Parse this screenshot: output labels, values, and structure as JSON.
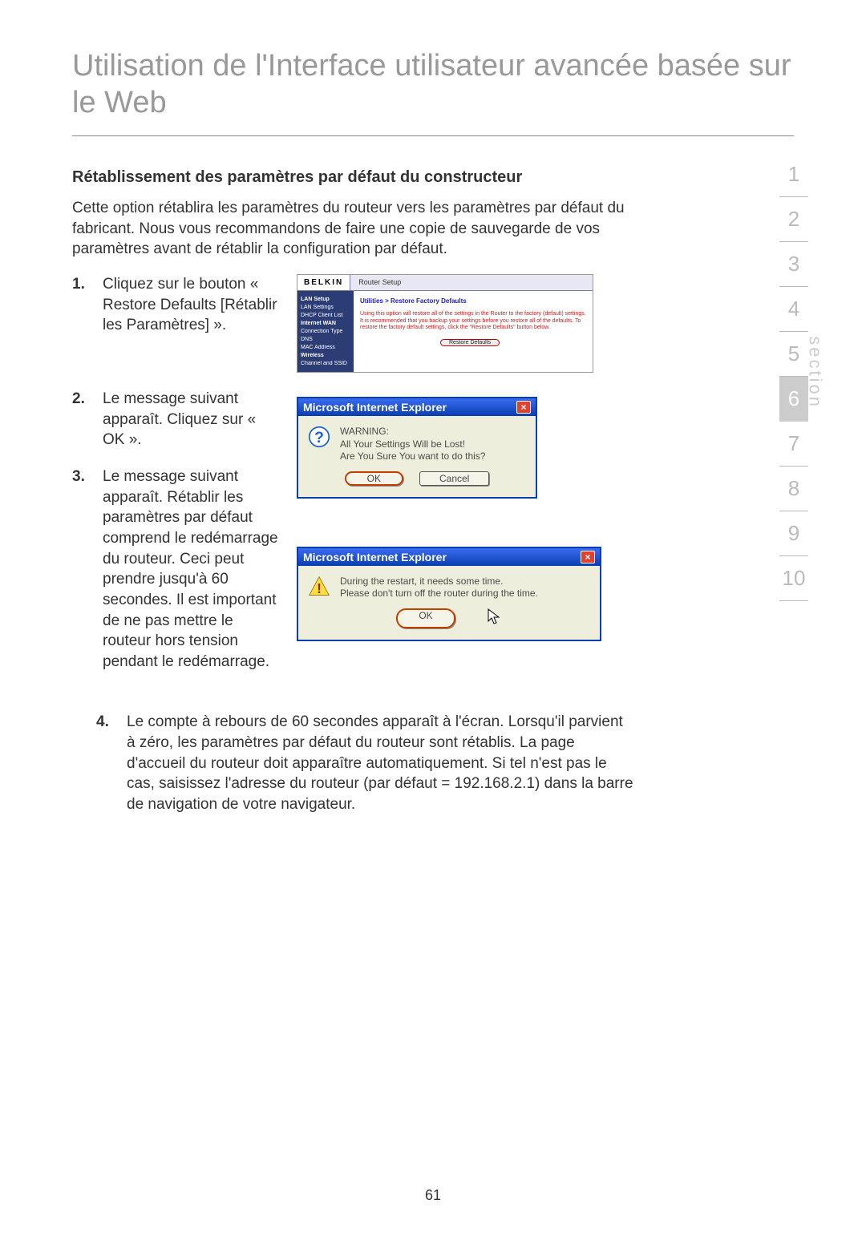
{
  "title": "Utilisation de l'Interface utilisateur avancée basée sur le Web",
  "section_heading": "Rétablissement des paramètres par défaut du constructeur",
  "intro": "Cette option rétablira les paramètres du routeur vers les paramètres par défaut du fabricant. Nous vous recommandons de faire une copie de sauvegarde de vos paramètres avant de rétablir la configuration par défaut.",
  "steps": {
    "s1": {
      "num": "1.",
      "text": "Cliquez sur le bouton « Restore Defaults [Rétablir les Paramètres] »."
    },
    "s2": {
      "num": "2.",
      "text": "Le message suivant apparaît. Cliquez sur « OK »."
    },
    "s3": {
      "num": "3.",
      "text": "Le message suivant apparaît. Rétablir les paramètres par défaut comprend le redémarrage du routeur. Ceci peut prendre jusqu'à 60 secondes. Il est important de ne pas mettre le routeur hors tension pendant le redémarrage."
    },
    "s4": {
      "num": "4.",
      "text": "Le compte à rebours de 60 secondes apparaît à l'écran. Lorsqu'il parvient à zéro, les paramètres par défaut du routeur sont rétablis. La page d'accueil du routeur doit apparaître automatiquement. Si tel n'est pas le cas, saisissez l'adresse du routeur (par défaut = 192.168.2.1) dans la barre de navigation de votre navigateur."
    }
  },
  "router": {
    "logo": "BELKIN",
    "tab": "Router Setup",
    "side": {
      "lan": "LAN Setup",
      "lan1": "LAN Settings",
      "lan2": "DHCP Client List",
      "wan": "Internet WAN",
      "wan1": "Connection Type",
      "wan2": "DNS",
      "wan3": "MAC Address",
      "wireless": "Wireless",
      "w1": "Channel and SSID"
    },
    "crumb": "Utilities > Restore Factory Defaults",
    "desc": "Using this option will restore all of the settings in the Router to the factory (default) settings. It is recommended that you backup your settings before you restore all of the defaults. To restore the factory default settings, click the \"Restore Defaults\" button below.",
    "button": "Restore Defaults"
  },
  "dialog1": {
    "title": "Microsoft Internet Explorer",
    "line1": "WARNING:",
    "line2": "All Your Settings Will be Lost!",
    "line3": "Are You Sure You want to do this?",
    "ok": "OK",
    "cancel": "Cancel"
  },
  "dialog2": {
    "title": "Microsoft Internet Explorer",
    "line1": "During the restart, it needs some time.",
    "line2": "Please don't turn off the router during the time.",
    "ok": "OK"
  },
  "nav": {
    "n1": "1",
    "n2": "2",
    "n3": "3",
    "n4": "4",
    "n5": "5",
    "n6": "6",
    "n7": "7",
    "n8": "8",
    "n9": "9",
    "n10": "10",
    "label": "section"
  },
  "page_number": "61"
}
